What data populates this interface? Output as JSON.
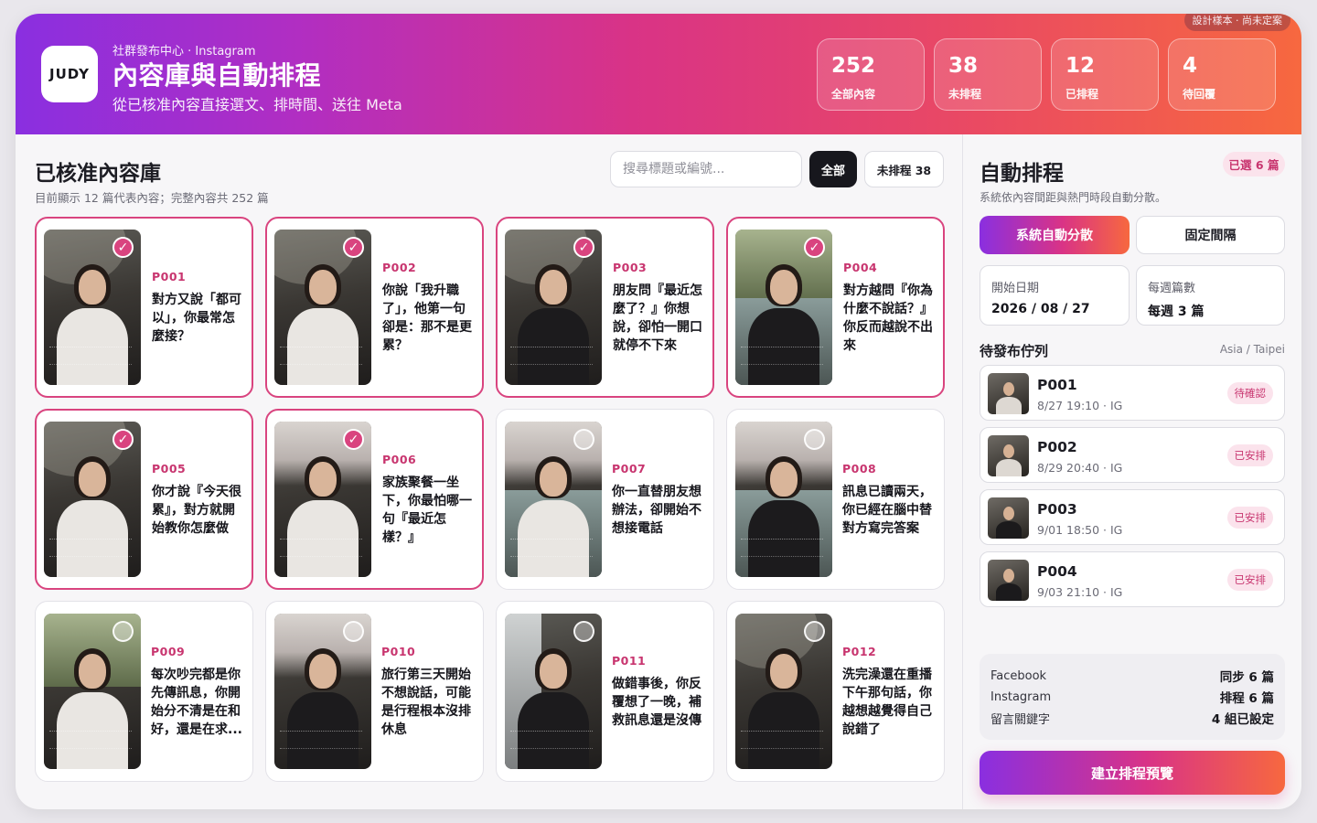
{
  "header": {
    "logo": "JUDY",
    "eyebrow": "社群發布中心 · Instagram",
    "title": "內容庫與自動排程",
    "subtitle": "從已核准內容直接選文、排時間、送往 Meta",
    "design_badge": "設計樣本 · 尚未定案",
    "stats": [
      {
        "value": "252",
        "label": "全部內容"
      },
      {
        "value": "38",
        "label": "未排程"
      },
      {
        "value": "12",
        "label": "已排程"
      },
      {
        "value": "4",
        "label": "待回覆"
      }
    ]
  },
  "library": {
    "title": "已核准內容庫",
    "note": "目前顯示 12 篇代表內容；完整內容共 252 篇",
    "search_placeholder": "搜尋標題或編號...",
    "filter_all": "全部",
    "filter_unscheduled": "未排程 38",
    "cards": [
      {
        "id": "P001",
        "title": "對方又說「都可以」，你最常怎麼接？",
        "selected": true
      },
      {
        "id": "P002",
        "title": "你說「我升職了」，他第一句卻是：那不是更累？",
        "selected": true
      },
      {
        "id": "P003",
        "title": "朋友問『最近怎麼了？』你想說，卻怕一開口就停不下來",
        "selected": true
      },
      {
        "id": "P004",
        "title": "對方越問『你為什麼不說話？』你反而越說不出來",
        "selected": true
      },
      {
        "id": "P005",
        "title": "你才說『今天很累』，對方就開始教你怎麼做",
        "selected": true
      },
      {
        "id": "P006",
        "title": "家族聚餐一坐下，你最怕哪一句『最近怎樣？』",
        "selected": true
      },
      {
        "id": "P007",
        "title": "你一直替朋友想辦法，卻開始不想接電話",
        "selected": false
      },
      {
        "id": "P008",
        "title": "訊息已讀兩天，你已經在腦中替對方寫完答案",
        "selected": false
      },
      {
        "id": "P009",
        "title": "每次吵完都是你先傳訊息，你開始分不清是在和好，還是在求...",
        "selected": false
      },
      {
        "id": "P010",
        "title": "旅行第三天開始不想說話，可能是行程根本沒排休息",
        "selected": false
      },
      {
        "id": "P011",
        "title": "做錯事後，你反覆想了一晚，補救訊息還是沒傳",
        "selected": false
      },
      {
        "id": "P012",
        "title": "洗完澡還在重播下午那句話，你越想越覺得自己說錯了",
        "selected": false
      }
    ]
  },
  "schedule": {
    "title": "自動排程",
    "selected_badge": "已選 6 篇",
    "note": "系統依內容間距與熱門時段自動分散。",
    "mode_auto": "系統自動分散",
    "mode_fixed": "固定間隔",
    "start_label": "開始日期",
    "start_value": "2026 / 08 / 27",
    "weekly_label": "每週篇數",
    "weekly_value": "每週 3 篇",
    "queue_title": "待發布佇列",
    "timezone": "Asia / Taipei",
    "queue": [
      {
        "id": "P001",
        "meta": "8/27 19:10 · IG",
        "status": "待確認"
      },
      {
        "id": "P002",
        "meta": "8/29 20:40 · IG",
        "status": "已安排"
      },
      {
        "id": "P003",
        "meta": "9/01 18:50 · IG",
        "status": "已安排"
      },
      {
        "id": "P004",
        "meta": "9/03 21:10 · IG",
        "status": "已安排"
      }
    ],
    "sync": [
      {
        "platform": "Facebook",
        "value": "同步 6 篇"
      },
      {
        "platform": "Instagram",
        "value": "排程 6 篇"
      },
      {
        "platform": "留言關鍵字",
        "value": "4 組已設定"
      }
    ],
    "cta": "建立排程預覽"
  },
  "colors": {
    "accent": "#d9447f",
    "gradient_start": "#8a2fe0",
    "gradient_end": "#f7683f"
  }
}
